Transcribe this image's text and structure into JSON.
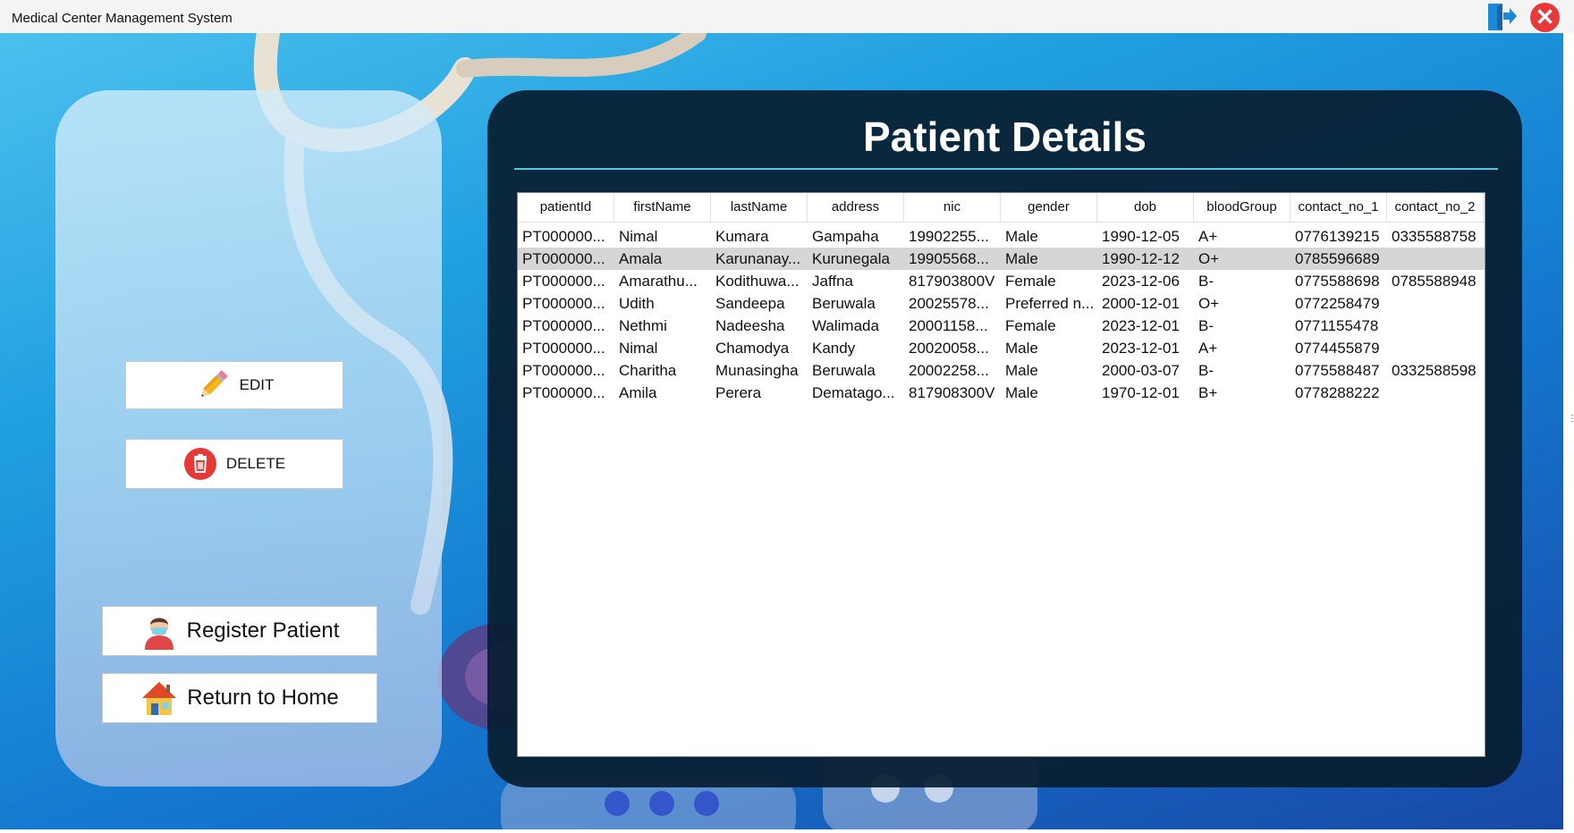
{
  "window": {
    "title": "Medical Center Management System"
  },
  "sidebar": {
    "edit_label": "EDIT",
    "delete_label": "DELETE",
    "register_label": "Register Patient",
    "home_label": "Return to Home"
  },
  "main": {
    "title": "Patient Details"
  },
  "table": {
    "columns": [
      "patientId",
      "firstName",
      "lastName",
      "address",
      "nic",
      "gender",
      "dob",
      "bloodGroup",
      "contact_no_1",
      "contact_no_2"
    ],
    "selected_row": 1,
    "rows": [
      [
        "PT000000...",
        "Nimal",
        "Kumara",
        "Gampaha",
        "19902255...",
        "Male",
        "1990-12-05",
        "A+",
        "0776139215",
        "0335588758"
      ],
      [
        "PT000000...",
        "Amala",
        "Karunanay...",
        "Kurunegala",
        "19905568...",
        "Male",
        "1990-12-12",
        "O+",
        "0785596689",
        ""
      ],
      [
        "PT000000...",
        "Amarathu...",
        "Kodithuwa...",
        "Jaffna",
        "817903800V",
        "Female",
        "2023-12-06",
        "B-",
        "0775588698",
        "0785588948"
      ],
      [
        "PT000000...",
        "Udith",
        "Sandeepa",
        "Beruwala",
        "20025578...",
        "Preferred n...",
        "2000-12-01",
        "O+",
        "0772258479",
        ""
      ],
      [
        "PT000000...",
        "Nethmi",
        "Nadeesha",
        "Walimada",
        "20001158...",
        "Female",
        "2023-12-01",
        "B-",
        "0771155478",
        ""
      ],
      [
        "PT000000...",
        "Nimal",
        "Chamodya",
        "Kandy",
        "20020058...",
        "Male",
        "2023-12-01",
        "A+",
        "0774455879",
        ""
      ],
      [
        "PT000000...",
        "Charitha",
        "Munasingha",
        "Beruwala",
        "20002258...",
        "Male",
        "2000-03-07",
        "B-",
        "0775588487",
        "0332588598"
      ],
      [
        "PT000000...",
        "Amila",
        "Perera",
        "Dematago...",
        "817908300V",
        "Male",
        "1970-12-01",
        "B+",
        "0778288222",
        ""
      ]
    ]
  },
  "icons": {
    "logout": "logout-icon",
    "close": "close-icon",
    "edit": "pencil-icon",
    "delete": "trash-icon",
    "register": "masked-person-icon",
    "home": "house-icon"
  },
  "colors": {
    "accent": "#58c6e6",
    "panel_dark": "#081e30",
    "close_red": "#e8393a",
    "selected_row": "#d6d6d6"
  }
}
